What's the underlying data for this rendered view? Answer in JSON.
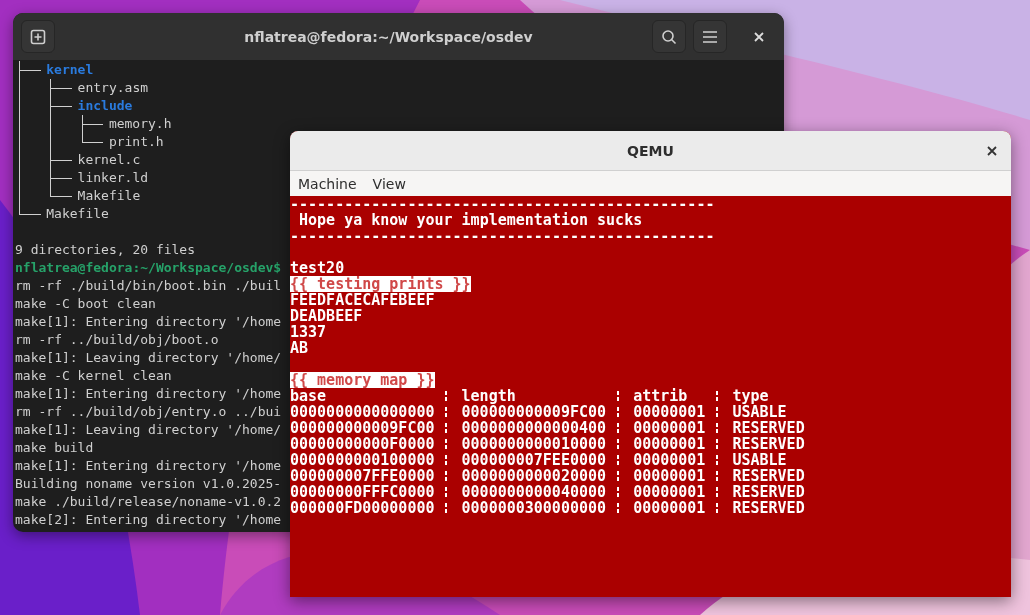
{
  "terminal": {
    "title": "nflatrea@fedora:~/Workspace/osdev",
    "tree": [
      {
        "name": "kernel",
        "kind": "dir",
        "children": [
          {
            "name": "entry.asm",
            "kind": "file"
          },
          {
            "name": "include",
            "kind": "dir",
            "children": [
              {
                "name": "memory.h",
                "kind": "file"
              },
              {
                "name": "print.h",
                "kind": "file"
              }
            ]
          },
          {
            "name": "kernel.c",
            "kind": "file"
          },
          {
            "name": "linker.ld",
            "kind": "file"
          },
          {
            "name": "Makefile",
            "kind": "file"
          }
        ]
      },
      {
        "name": "Makefile",
        "kind": "file"
      }
    ],
    "summary": "9 directories, 20 files",
    "lines": [
      {
        "kind": "prompt",
        "text": "nflatrea@fedora:~/Workspace/osdev$"
      },
      {
        "kind": "output",
        "text": "rm -rf ./build/bin/boot.bin ./buil"
      },
      {
        "kind": "output",
        "text": "make -C boot clean"
      },
      {
        "kind": "output",
        "text": "make[1]: Entering directory '/home"
      },
      {
        "kind": "output",
        "text": "rm -rf ../build/obj/boot.o"
      },
      {
        "kind": "output",
        "text": "make[1]: Leaving directory '/home/"
      },
      {
        "kind": "output",
        "text": "make -C kernel clean"
      },
      {
        "kind": "output",
        "text": "make[1]: Entering directory '/home"
      },
      {
        "kind": "output",
        "text": "rm -rf ../build/obj/entry.o ../bui"
      },
      {
        "kind": "output",
        "text": "make[1]: Leaving directory '/home/"
      },
      {
        "kind": "output",
        "text": "make build"
      },
      {
        "kind": "output",
        "text": "make[1]: Entering directory '/home"
      },
      {
        "kind": "output",
        "text": "Building noname version v1.0.2025-"
      },
      {
        "kind": "output",
        "text": "make ./build/release/noname-v1.0.2"
      },
      {
        "kind": "output",
        "text": "make[2]: Entering directory '/home"
      }
    ]
  },
  "qemu": {
    "title": "QEMU",
    "menu": [
      "Machine",
      "View"
    ],
    "screen": [
      {
        "kind": "text",
        "text": "-----------------------------------------------"
      },
      {
        "kind": "text",
        "text": " Hope ya know your implementation sucks"
      },
      {
        "kind": "text",
        "text": "-----------------------------------------------"
      },
      {
        "kind": "blank"
      },
      {
        "kind": "text",
        "text": "test20"
      },
      {
        "kind": "highlight",
        "text": "{{ testing prints }}"
      },
      {
        "kind": "text",
        "text": "FEEDFACECAFEBEEF"
      },
      {
        "kind": "text",
        "text": "DEADBEEF"
      },
      {
        "kind": "text",
        "text": "1337"
      },
      {
        "kind": "text",
        "text": "AB"
      },
      {
        "kind": "blank"
      },
      {
        "kind": "highlight",
        "text": "{{ memory map }}"
      }
    ],
    "memory_map": {
      "columns": [
        "base",
        "length",
        "attrib",
        "type"
      ],
      "rows": [
        [
          "0000000000000000",
          "000000000009FC00",
          "00000001",
          "USABLE"
        ],
        [
          "000000000009FC00",
          "0000000000000400",
          "00000001",
          "RESERVED"
        ],
        [
          "00000000000F0000",
          "0000000000010000",
          "00000001",
          "RESERVED"
        ],
        [
          "0000000000100000",
          "000000007FEE0000",
          "00000001",
          "USABLE"
        ],
        [
          "000000007FFE0000",
          "0000000000020000",
          "00000001",
          "RESERVED"
        ],
        [
          "00000000FFFC0000",
          "0000000000040000",
          "00000001",
          "RESERVED"
        ],
        [
          "000000FD00000000",
          "0000000300000000",
          "00000001",
          "RESERVED"
        ]
      ]
    }
  }
}
